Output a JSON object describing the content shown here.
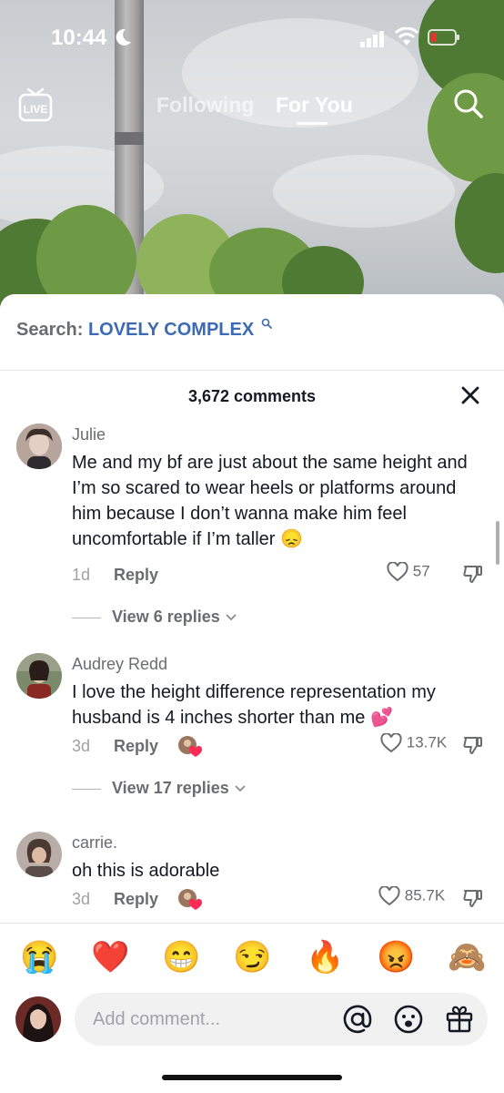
{
  "status_bar": {
    "time": "10:44"
  },
  "top_nav": {
    "live_label": "LIVE",
    "tabs": [
      {
        "label": "Following"
      },
      {
        "label": "For You"
      }
    ]
  },
  "comments_sheet": {
    "search_prefix": "Search:",
    "search_term": "LOVELY COMPLEX",
    "count_title": "3,672 comments",
    "comments": [
      {
        "user": "Julie",
        "text": "Me and my bf are just about the same height and I’m so scared to wear heels or platforms around him because I don’t wanna make him feel uncomfortable if I’m taller",
        "emoji": "😞",
        "date": "1d",
        "reply_label": "Reply",
        "likes": "57",
        "view_replies": "View 6 replies"
      },
      {
        "user": "Audrey Redd",
        "text": "I love the height difference representation my husband is 4 inches shorter than me",
        "emoji": "💕",
        "date": "3d",
        "reply_label": "Reply",
        "likes": "13.7K",
        "view_replies": "View 17 replies"
      },
      {
        "user": "carrie.",
        "text": "oh this is adorable",
        "date": "3d",
        "reply_label": "Reply",
        "likes": "85.7K"
      }
    ]
  },
  "emoji_bar": [
    "😭",
    "❤️",
    "😁",
    "😏",
    "🔥",
    "😡",
    "🙈"
  ],
  "comment_input": {
    "placeholder": "Add comment..."
  },
  "colors": {
    "search_term": "#3d6ab5",
    "secondary_text": "#6a6c70",
    "input_bg": "#f1f1f2"
  }
}
